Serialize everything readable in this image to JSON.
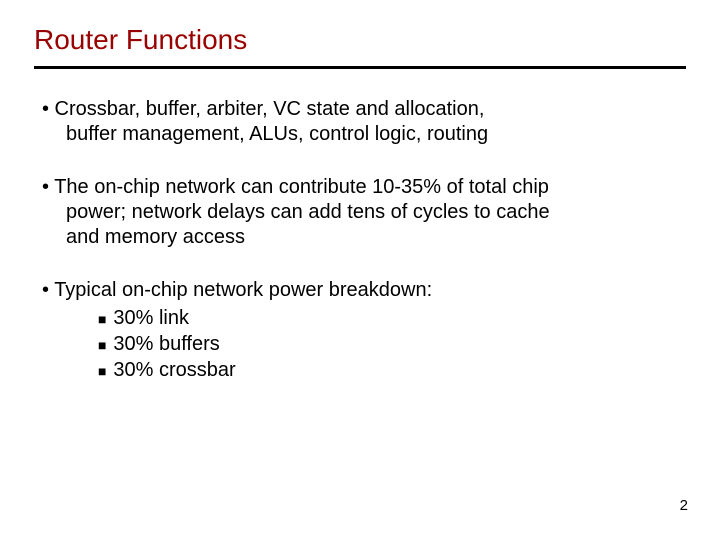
{
  "title": "Router Functions",
  "bullets": {
    "b1_line1": "• Crossbar, buffer, arbiter, VC state and allocation,",
    "b1_line2": "buffer management, ALUs, control logic, routing",
    "b2_line1": "• The on-chip network can contribute 10-35% of total chip",
    "b2_line2": "power;  network delays can add tens of cycles to cache",
    "b2_line3": "and memory access",
    "b3_line1": "• Typical on-chip network power breakdown:"
  },
  "subitems": {
    "s1": "30% link",
    "s2": "30% buffers",
    "s3": "30% crossbar"
  },
  "square": "■",
  "page_number": "2"
}
